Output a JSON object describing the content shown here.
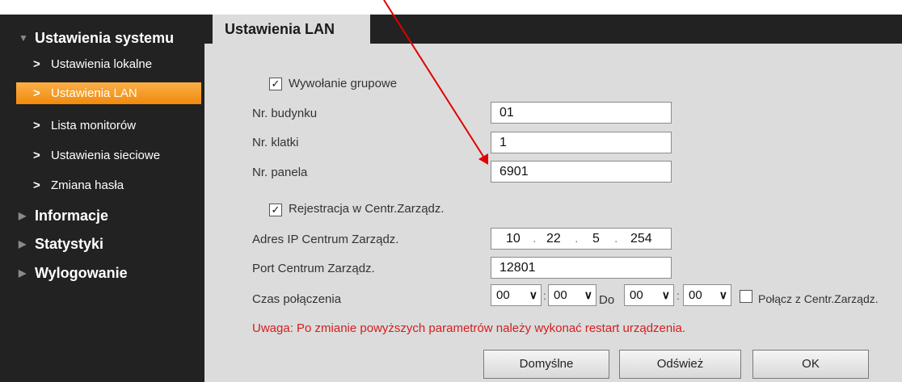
{
  "sidebar": {
    "system_settings": "Ustawienia systemu",
    "items": [
      {
        "label": "Ustawienia lokalne"
      },
      {
        "label": "Ustawienia LAN"
      },
      {
        "label": "Lista monitorów"
      },
      {
        "label": "Ustawienia sieciowe"
      },
      {
        "label": "Zmiana hasła"
      }
    ],
    "information": "Informacje",
    "statistics": "Statystyki",
    "logout": "Wylogowanie"
  },
  "tab": {
    "label": "Ustawienia LAN"
  },
  "form": {
    "group_call": {
      "label": "Wywołanie grupowe",
      "checked": true
    },
    "building_no": {
      "label": "Nr. budynku",
      "value": "01"
    },
    "stairwell_no": {
      "label": "Nr. klatki",
      "value": "1"
    },
    "panel_no": {
      "label": "Nr. panela",
      "value": "6901"
    },
    "register": {
      "label": "Rejestracja w Centr.Zarządz.",
      "checked": true
    },
    "mgmt_ip": {
      "label": "Adres IP Centrum Zarządz.",
      "octets": [
        "10",
        "22",
        "5",
        "254"
      ]
    },
    "mgmt_port": {
      "label": "Port Centrum Zarządz.",
      "value": "12801"
    },
    "conn_time": {
      "label": "Czas połączenia",
      "from_hour": "00",
      "from_min": "00",
      "to_label": "Do",
      "to_hour": "00",
      "to_min": "00",
      "connect_label": "Połącz z Centr.Zarządz.",
      "connect_checked": false
    }
  },
  "warning": "Uwaga: Po zmianie powyższych parametrów należy wykonać restart urządzenia.",
  "buttons": {
    "default": "Domyślne",
    "refresh": "Odśwież",
    "ok": "OK"
  },
  "colors": {
    "accent": "#f59a1b",
    "warning": "#d51d1d",
    "annotation_arrow": "#e00000"
  }
}
